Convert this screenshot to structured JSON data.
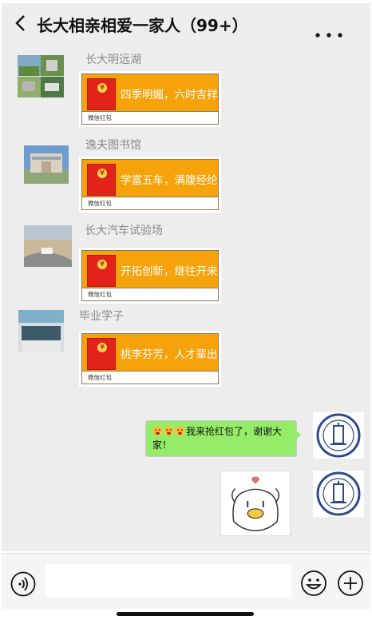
{
  "header": {
    "title": "长大相亲相爱一家人（99+）"
  },
  "messages": [
    {
      "sender": "长大明远湖",
      "red_packet_text": "四季明媚，六时吉祥",
      "red_packet_label": "微信红包"
    },
    {
      "sender": "逸夫图书馆",
      "red_packet_text": "学富五车，满腹经纶",
      "red_packet_label": "微信红包"
    },
    {
      "sender": "长大汽车试验场",
      "red_packet_text": "开拓创新，继往开来",
      "red_packet_label": "微信红包"
    },
    {
      "sender": "毕业学子",
      "red_packet_text": "桃李芬芳，人才辈出",
      "red_packet_label": "微信红包"
    }
  ],
  "my_message": {
    "text": "我来抢红包了，谢谢大家！"
  },
  "colors": {
    "red_packet": "#f6a20a",
    "envelope": "#e2231a",
    "my_bubble": "#95ec69",
    "chat_bg": "#ededed",
    "seal": "#2d4a8c"
  },
  "icons": {
    "back": "chevron-left-icon",
    "more": "more-dots-icon",
    "voice": "voice-icon",
    "emoji": "smile-icon",
    "add": "plus-icon"
  }
}
